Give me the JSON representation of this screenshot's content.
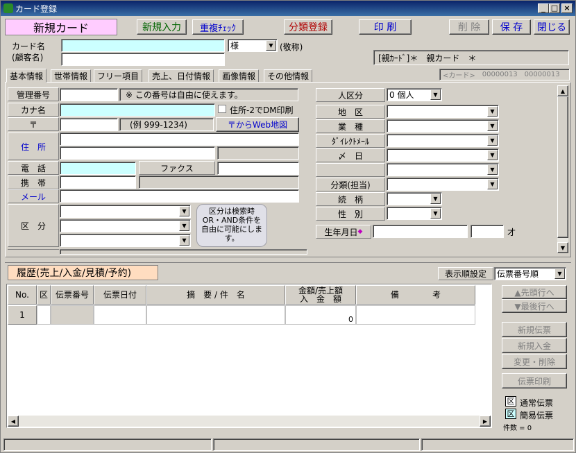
{
  "window": {
    "title": "カード登録",
    "min": "_",
    "max": "□",
    "close": "×"
  },
  "toolbar": {
    "title": "新規カード",
    "new_entry": "新規入力",
    "dup_check": "重複ﾁｪｯｸ",
    "class_register": "分類登録",
    "print": "印 刷",
    "delete": "削 除",
    "save": "保 存",
    "close": "閉じる"
  },
  "header": {
    "card_name_label": "カード名",
    "customer_name_label": "(顧客名)",
    "honorific_value": "様",
    "honorific_note": "(敬称)",
    "parent_card": "[親ｶｰﾄﾞ]＊　親カード　＊"
  },
  "tabs": [
    "基本情報",
    "世帯情報",
    "フリー項目",
    "売上、日付情報",
    "画像情報",
    "その他情報"
  ],
  "card_nav": {
    "label": "<カード>",
    "from": "00000013",
    "to": "00000013"
  },
  "form": {
    "mgmt_no_label": "管理番号",
    "mgmt_no_note": "※ この番号は自由に使えます。",
    "kana_label": "カナ名",
    "dm_label": "住所-2でDM印刷",
    "zip_label": "〒",
    "zip_example": "(例 999-1234)",
    "web_map": "〒からWeb地図",
    "address_label": "住　所",
    "phone_label": "電　話",
    "fax_label": "ファクス",
    "mobile_label": "携　帯",
    "mail_label": "メール",
    "class_label": "区　分",
    "class_note": "区分は検索時OR・AND条件を自由に可能にします。"
  },
  "right": {
    "person_type_label": "人区分",
    "person_type_value": "0 個人",
    "area_label": "地　区",
    "industry_label": "業　種",
    "direct_mail_label": "ﾀﾞｲﾚｸﾄﾒｰﾙ",
    "deadline_label": "〆　日",
    "class_staff_label": "分類(担当)",
    "relation_label": "続　柄",
    "gender_label": "性　別",
    "birthday_label": "生年月日",
    "age_unit": "才"
  },
  "history": {
    "title": "履歴(売上/入金/見積/予約)",
    "sort_label": "表示順設定",
    "sort_value": "伝票番号順",
    "columns": [
      "No.",
      "区",
      "伝票番号",
      "伝票日付",
      "摘　要 / 件　名",
      "金額/売上額\n入　金　額",
      "備　　　　考"
    ],
    "rows": [
      {
        "no": "1",
        "amount": "0"
      }
    ]
  },
  "side_buttons": {
    "first": "▲先頭行へ",
    "last": "▼最後行へ",
    "new_slip": "新規伝票",
    "new_payment": "新規入金",
    "edit_delete": "変更・削除",
    "print_slip": "伝票印刷"
  },
  "legend": {
    "normal": "通常伝票",
    "simple": "簡易伝票",
    "count": "件数 = 0",
    "box": "区"
  },
  "colors": {
    "accent_pink": "#ffccff",
    "cyan": "#ccffff",
    "history_header": "#ffddc0"
  }
}
